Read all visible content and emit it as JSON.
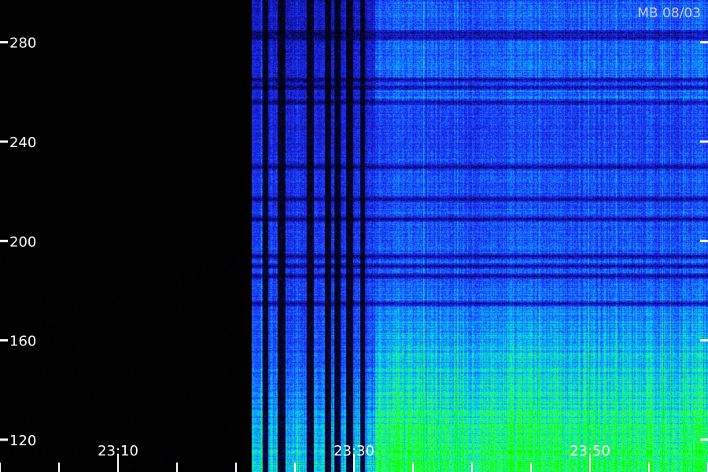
{
  "chart_data": {
    "type": "heatmap",
    "title": "",
    "stamp": "MB 08/03",
    "xlabel": "",
    "ylabel": "",
    "y_ticks": [
      280,
      240,
      200,
      160,
      120
    ],
    "y_tick_labels": [
      "280",
      "240",
      "200",
      "160",
      "120"
    ],
    "ylim": [
      107,
      297
    ],
    "x_tick_labels": [
      "23:10",
      "23:30",
      "23:50"
    ],
    "x_label_minutes": [
      1390,
      1410,
      1430
    ],
    "xlim_minutes": [
      1380,
      1440
    ],
    "x_minor_step_minutes": 5,
    "data_start_minute": 1401.3,
    "broadband_onset_minute": 1411.8,
    "dropout_bands_minutes": [
      [
        1402.2,
        1402.6
      ],
      [
        1403.5,
        1404.0
      ],
      [
        1406.0,
        1406.4
      ],
      [
        1407.5,
        1407.9
      ],
      [
        1408.3,
        1408.7
      ],
      [
        1409.3,
        1409.8
      ],
      [
        1410.5,
        1410.8
      ]
    ],
    "noise_band_values": [
      284,
      282,
      265,
      262,
      256,
      230,
      217,
      209,
      194,
      190,
      186,
      175
    ],
    "colormap": [
      "#000000",
      "#1010a0",
      "#2030ff",
      "#1090ff",
      "#00e0e0",
      "#40ff60",
      "#00ff00"
    ],
    "grid": false,
    "legend": "none"
  }
}
